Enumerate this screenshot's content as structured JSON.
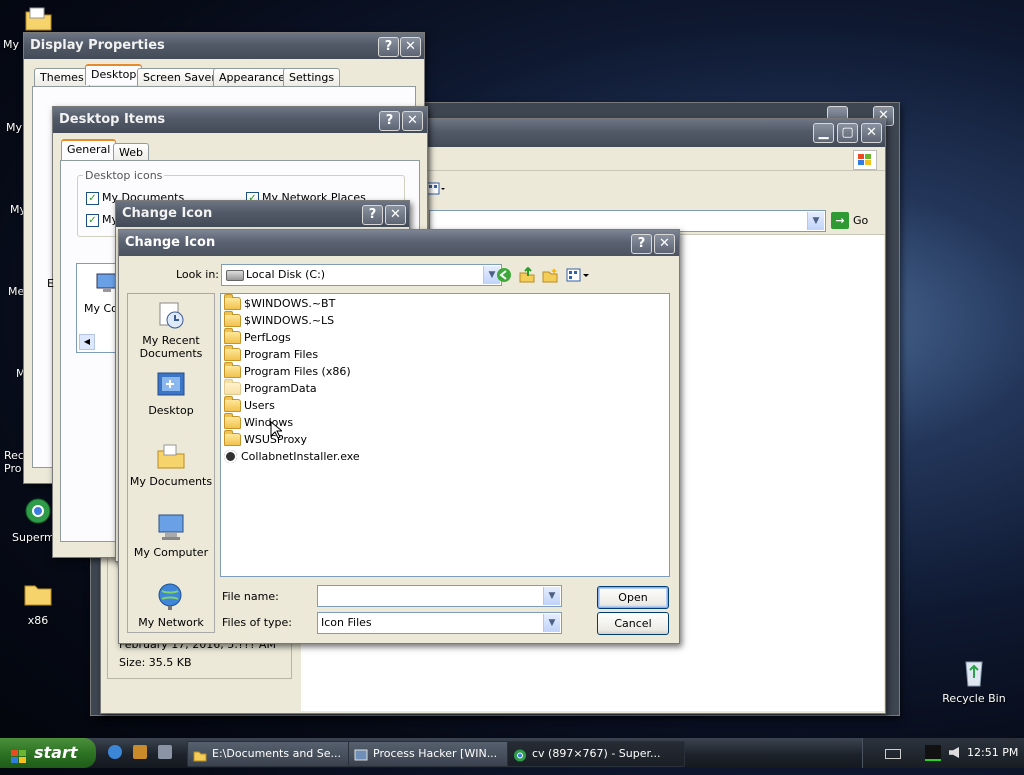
{
  "desktop": {
    "icons": [
      {
        "label": "My Documents (partial)",
        "short": "My D"
      },
      {
        "label": "My",
        "short": "My"
      },
      {
        "label": "My",
        "short": "My"
      },
      {
        "label": "Me",
        "short": "Me"
      },
      {
        "label": "M",
        "short": "M"
      },
      {
        "label": "Rec Pro",
        "short": "Rec\nPro"
      },
      {
        "label": "Supermi",
        "short": "Supermi"
      },
      {
        "label": "x86",
        "short": "x86"
      },
      {
        "label": "Recycle Bin",
        "short": "Recycle Bin"
      }
    ]
  },
  "display_properties": {
    "title": "Display Properties",
    "tabs": [
      "Themes",
      "Desktop",
      "Screen Saver",
      "Appearance",
      "Settings"
    ],
    "selected_tab": "Desktop"
  },
  "desktop_items": {
    "title": "Desktop Items",
    "tabs": [
      "General",
      "Web"
    ],
    "group_label": "Desktop icons",
    "checkboxes": [
      "My Documents",
      "My Network Places",
      "My"
    ],
    "list_item_partial": "My Co",
    "partial_e": "E"
  },
  "explorer": {
    "go_label": "Go",
    "details": [
      "February 17, 2016, 5:??? AM",
      "Size: 35.5 KB"
    ]
  },
  "change_icon_back": {
    "title": "Change Icon"
  },
  "change_icon": {
    "title": "Change Icon",
    "look_in_label": "Look in:",
    "look_in_value": "Local Disk (C:)",
    "places": [
      "My Recent Documents",
      "Desktop",
      "My Documents",
      "My Computer",
      "My Network"
    ],
    "files": [
      {
        "name": "$WINDOWS.~BT",
        "type": "folder"
      },
      {
        "name": "$WINDOWS.~LS",
        "type": "folder"
      },
      {
        "name": "PerfLogs",
        "type": "folder"
      },
      {
        "name": "Program Files",
        "type": "folder"
      },
      {
        "name": "Program Files (x86)",
        "type": "folder"
      },
      {
        "name": "ProgramData",
        "type": "folder-ghost"
      },
      {
        "name": "Users",
        "type": "folder"
      },
      {
        "name": "Windows",
        "type": "folder"
      },
      {
        "name": "WSUSProxy",
        "type": "folder"
      },
      {
        "name": "CollabnetInstaller.exe",
        "type": "exe"
      }
    ],
    "file_name_label": "File name:",
    "file_name_value": "",
    "files_of_type_label": "Files of type:",
    "files_of_type_value": "Icon Files",
    "open_label": "Open",
    "cancel_label": "Cancel"
  },
  "taskbar": {
    "start_label": "start",
    "buttons": [
      "E:\\Documents and Se...",
      "Process Hacker [WIN...",
      "cv (897×767) - Super..."
    ],
    "clock": "12:51 PM"
  },
  "colors": {
    "accent_tab": "#e68b2c",
    "start_green": "#2e7424",
    "title_gray": "#5b6372"
  }
}
